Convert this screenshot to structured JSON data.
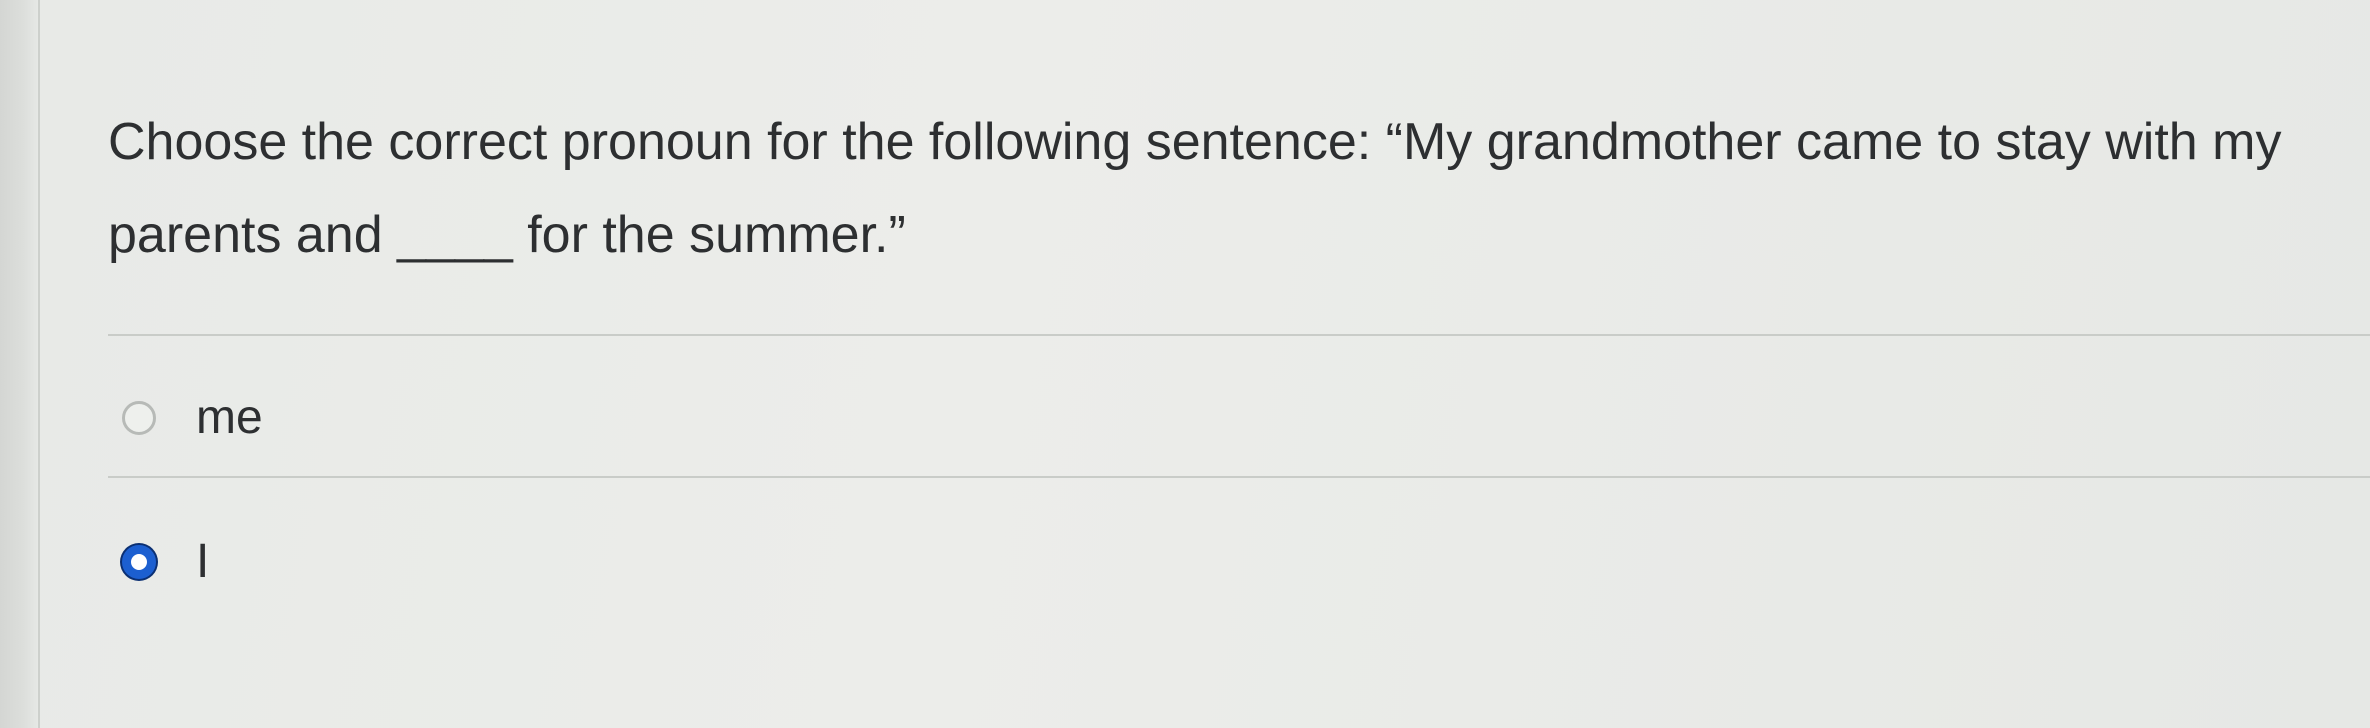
{
  "question": {
    "text": "Choose the correct pronoun for the following sentence: “My grandmother came to stay with my parents and ____ for the summer.”"
  },
  "answers": [
    {
      "label": "me",
      "selected": false
    },
    {
      "label": "I",
      "selected": true
    }
  ],
  "colors": {
    "selected_radio": "#1c5fd0",
    "text": "#2d2f31",
    "background": "#e9ebe8"
  }
}
